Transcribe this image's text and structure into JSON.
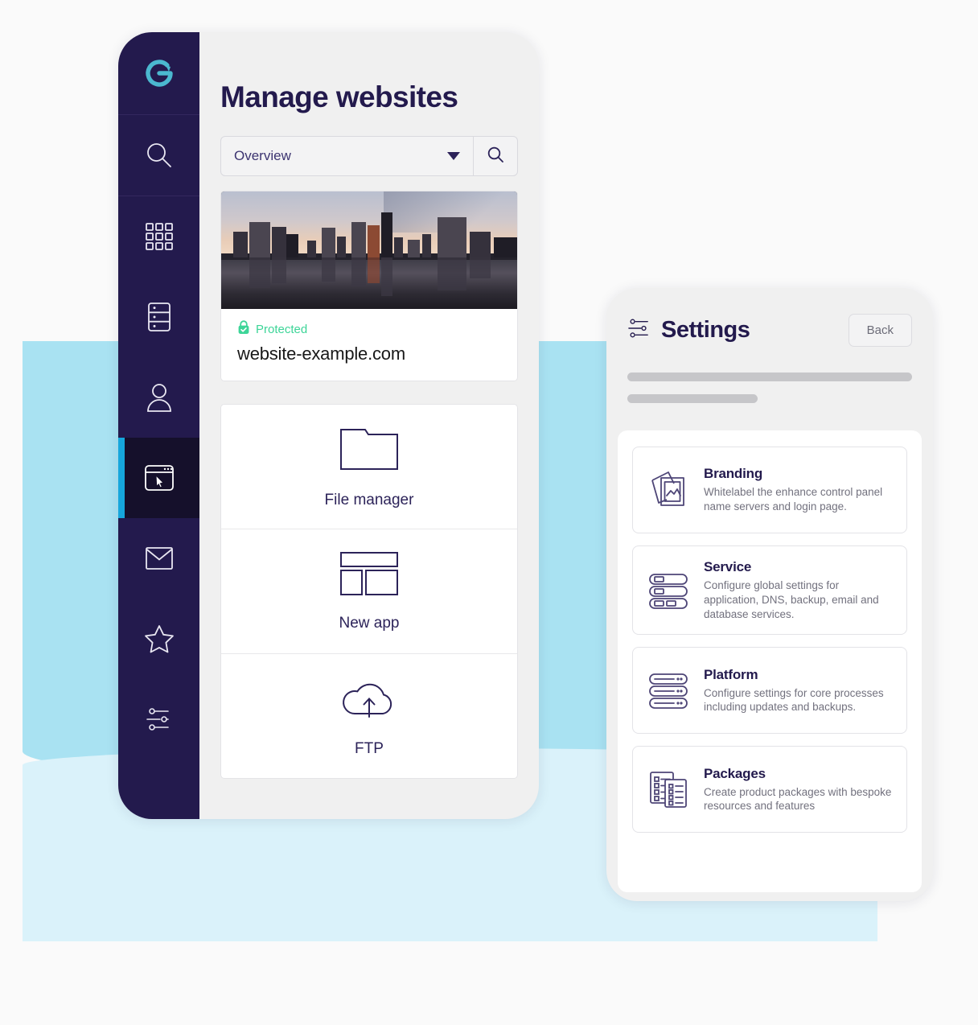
{
  "theme": {
    "brand_navy": "#231a4d",
    "brand_teal": "#4bb8cf",
    "accent_cyan": "#16a6dc",
    "success_green": "#3dd598",
    "bg_blue_mid": "#a9e2f2",
    "bg_blue_light": "#daf2fa",
    "page_bg": "#fafafa"
  },
  "left_phone": {
    "sidebar": {
      "logo": {
        "icon": "enhance-e-logo-icon",
        "label": "Enhance"
      },
      "items": [
        {
          "icon": "search-icon",
          "label": "Search",
          "active": false
        },
        {
          "icon": "grid-apps-icon",
          "label": "Apps",
          "active": false
        },
        {
          "icon": "server-stack-icon",
          "label": "Servers",
          "active": false
        },
        {
          "icon": "user-icon",
          "label": "Users",
          "active": false
        },
        {
          "icon": "window-cursor-icon",
          "label": "Websites",
          "active": true
        },
        {
          "icon": "envelope-icon",
          "label": "Email",
          "active": false
        },
        {
          "icon": "star-icon",
          "label": "Favorites",
          "active": false
        },
        {
          "icon": "sliders-icon",
          "label": "Settings",
          "active": false
        }
      ]
    },
    "header": {
      "title": "Manage websites"
    },
    "search": {
      "selected_option": "Overview",
      "options": [
        "Overview"
      ],
      "dropdown_icon": "chevron-down-icon",
      "search_icon": "search-icon"
    },
    "site_card": {
      "photo_alt": "city-skyline-reflection-photo",
      "status_icon": "lock-check-icon",
      "status_label": "Protected",
      "domain": "website-example.com"
    },
    "tiles": [
      {
        "icon": "folder-icon",
        "label": "File manager"
      },
      {
        "icon": "app-layout-icon",
        "label": "New app"
      },
      {
        "icon": "cloud-upload-icon",
        "label": "FTP"
      }
    ]
  },
  "right_phone": {
    "header": {
      "icon": "sliders-icon",
      "title": "Settings",
      "back_label": "Back"
    },
    "settings_items": [
      {
        "icon": "images-icon",
        "name": "Branding",
        "desc": "Whitelabel the enhance control panel name servers and login page."
      },
      {
        "icon": "server-stack-icon",
        "name": "Service",
        "desc": "Configure global settings for application, DNS, backup, email and database services."
      },
      {
        "icon": "platform-bars-icon",
        "name": "Platform",
        "desc": "Configure settings for core processes including updates and backups."
      },
      {
        "icon": "checklist-docs-icon",
        "name": "Packages",
        "desc": "Create product packages with bespoke resources and features"
      }
    ]
  }
}
